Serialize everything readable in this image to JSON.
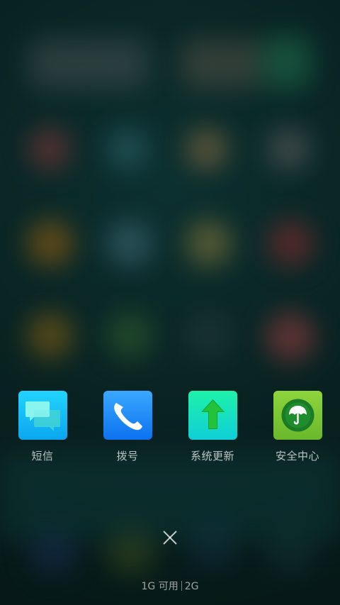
{
  "recent_apps": [
    {
      "label": "短信",
      "icon": "messages-icon",
      "color": "#1ac8ff"
    },
    {
      "label": "拨号",
      "icon": "phone-icon",
      "color": "#1b8cff"
    },
    {
      "label": "系统更新",
      "icon": "system-update-icon",
      "color": "#18e3c0"
    },
    {
      "label": "安全中心",
      "icon": "security-center-icon",
      "color": "#7cc534"
    }
  ],
  "close_icon": "close-icon",
  "memory": {
    "free": "1G 可用",
    "total": "2G"
  }
}
